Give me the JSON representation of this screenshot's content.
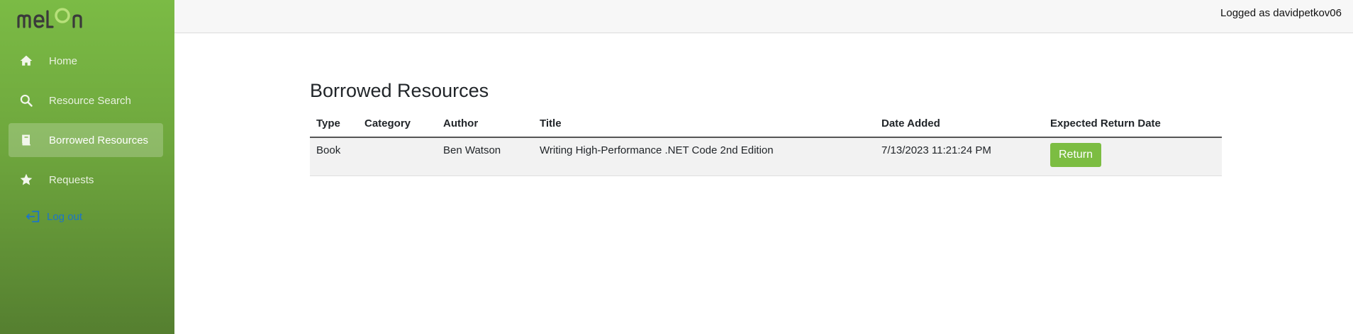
{
  "brand": {
    "logo_text": "meLon",
    "accent": "#7bbb45",
    "link_color": "#1c74c9"
  },
  "sidebar": {
    "items": [
      {
        "label": "Home",
        "icon": "home-icon",
        "active": false
      },
      {
        "label": "Resource Search",
        "icon": "search-icon",
        "active": false
      },
      {
        "label": "Borrowed Resources",
        "icon": "book-icon",
        "active": true
      },
      {
        "label": "Requests",
        "icon": "star-icon",
        "active": false
      }
    ],
    "logout_label": "Log out"
  },
  "topbar": {
    "logged_text": "Logged as davidpetkov06"
  },
  "main": {
    "title": "Borrowed Resources",
    "columns": [
      "Type",
      "Category",
      "Author",
      "Title",
      "Date Added",
      "Expected Return Date"
    ],
    "rows": [
      {
        "type": "Book",
        "category": "",
        "author": "Ben Watson",
        "title": "Writing High-Performance .NET Code 2nd Edition",
        "date_added": "7/13/2023 11:21:24 PM",
        "action_label": "Return"
      }
    ]
  }
}
